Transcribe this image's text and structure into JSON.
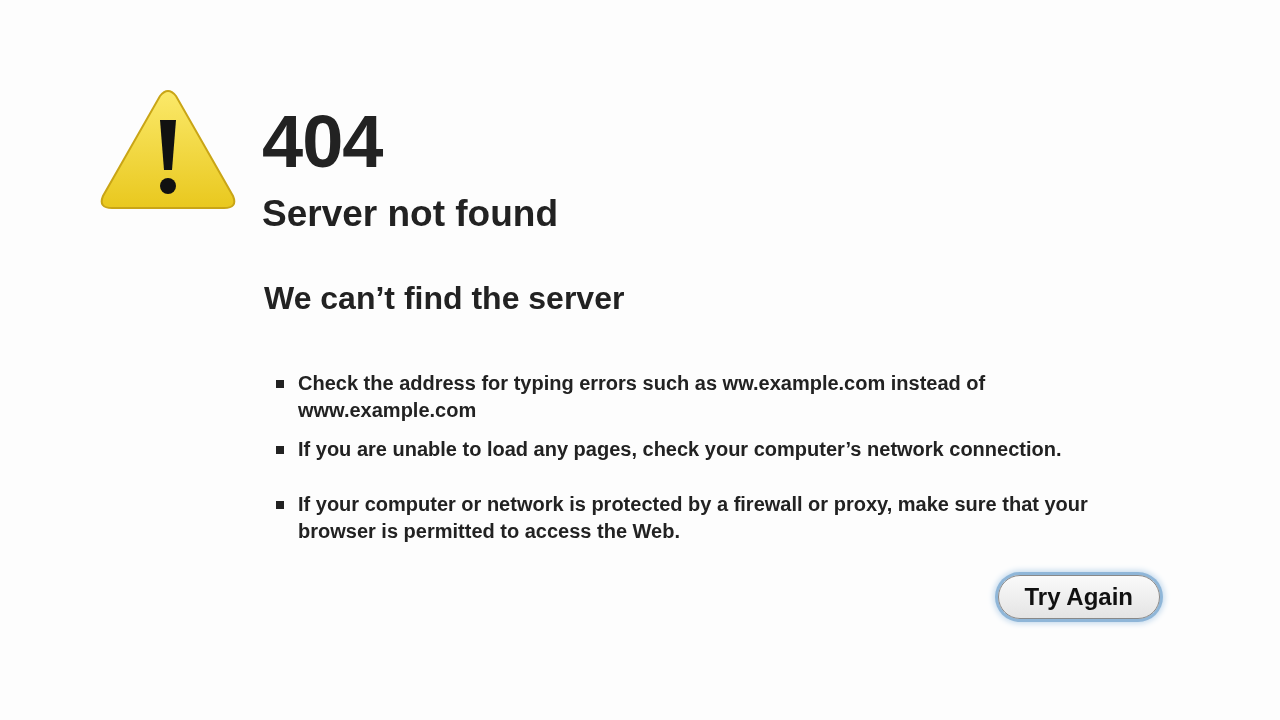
{
  "error_code": "404",
  "title": "Server not found",
  "subtitle": "We can’t find the server",
  "suggestions": [
    "Check the address for typing errors such as ww.example.com instead of www.example.com",
    "If you are unable to load any pages, check your computer’s network connection.",
    "If your computer or network is protected by a firewall or proxy, make sure that your browser is permitted to access the Web."
  ],
  "button": "Try Again"
}
